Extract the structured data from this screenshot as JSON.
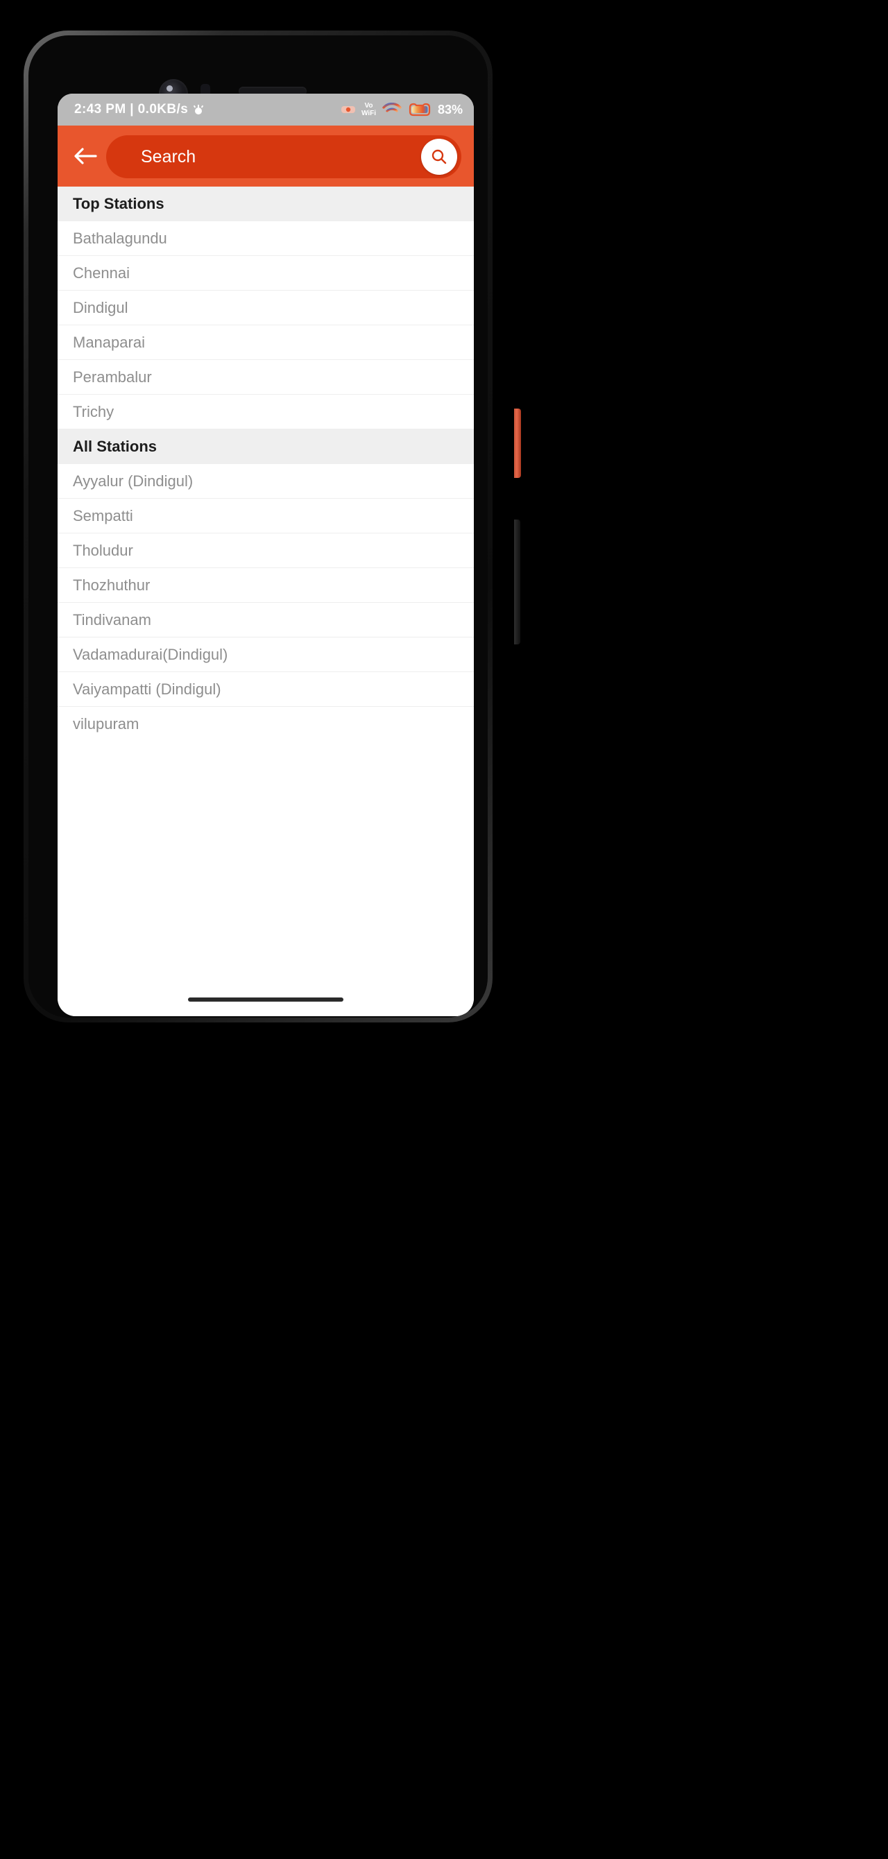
{
  "status_bar": {
    "time_and_speed": "2:43 PM | 0.0KB/s",
    "alarm_icon": "alarm-icon",
    "sim_icon": "sim-signal-icon",
    "volte_line1": "Vo",
    "volte_line2": "WiFi",
    "wifi_icon": "wifi-icon",
    "battery_icon": "battery-icon",
    "battery_percent": "83%"
  },
  "app_bar": {
    "back_icon": "back-arrow-icon",
    "search_placeholder": "Search",
    "search_value": "",
    "search_icon": "search-icon",
    "background_color": "#e8562d",
    "pill_color": "#d6370f"
  },
  "list": {
    "sections": [
      {
        "header": "Top Stations",
        "items": [
          "Bathalagundu",
          "Chennai",
          "Dindigul",
          "Manaparai",
          "Perambalur",
          "Trichy"
        ]
      },
      {
        "header": "All Stations",
        "items": [
          "Ayyalur (Dindigul)",
          "Sempatti",
          "Tholudur",
          "Thozhuthur",
          "Tindivanam",
          "Vadamadurai(Dindigul)",
          "Vaiyampatti (Dindigul)",
          "vilupuram"
        ]
      }
    ]
  },
  "navigation": {
    "gesture_pill": "home-gesture-pill"
  }
}
